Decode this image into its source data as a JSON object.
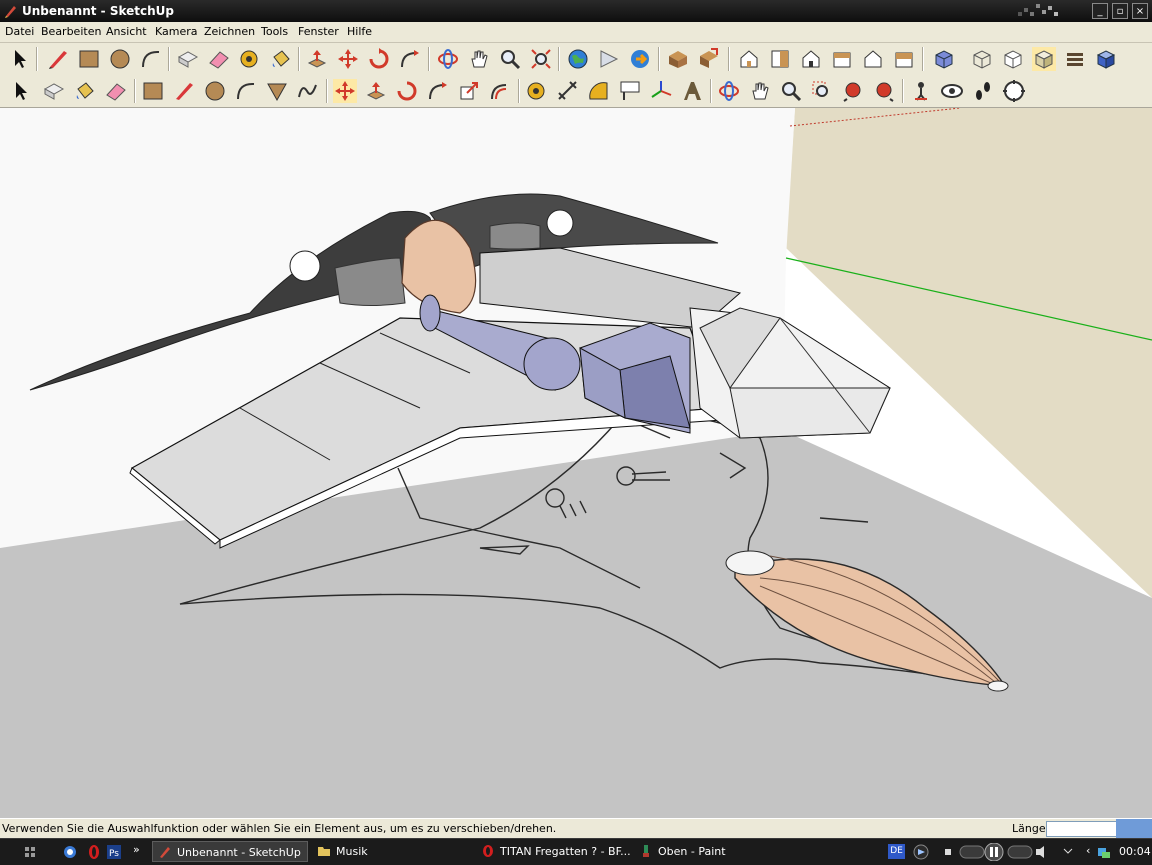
{
  "window": {
    "title": "Unbenannt - SketchUp",
    "controls": {
      "minimize": "_",
      "maximize": "▫",
      "close": "×"
    }
  },
  "menu": [
    {
      "label": "Datei"
    },
    {
      "label": "Bearbeiten"
    },
    {
      "label": "Ansicht"
    },
    {
      "label": "Kamera"
    },
    {
      "label": "Zeichnen"
    },
    {
      "label": "Tools"
    },
    {
      "label": "Fenster"
    },
    {
      "label": "Hilfe"
    }
  ],
  "toolbar1": {
    "tools": [
      "select-icon",
      "line-icon",
      "rectangle-icon",
      "circle-icon",
      "arc-icon",
      "make-component-icon",
      "eraser-icon",
      "tape-measure-icon",
      "paint-bucket-icon",
      "push-pull-icon",
      "move-icon",
      "rotate-icon",
      "follow-me-icon",
      "orbit-icon",
      "pan-icon",
      "zoom-icon",
      "zoom-extents-icon",
      "earth-icon",
      "get-models-icon",
      "share-model-icon",
      "component-icon",
      "add-component-icon",
      "iso-view-icon",
      "top-view-icon",
      "front-view-icon",
      "right-view-icon",
      "back-view-icon",
      "left-view-icon",
      "xray-icon",
      "wireframe-icon",
      "hidden-line-icon",
      "shaded-icon",
      "shaded-textures-icon",
      "monochrome-icon"
    ]
  },
  "toolbar2": {
    "tools": [
      "select-icon",
      "make-component-icon",
      "paint-bucket-icon",
      "eraser-icon",
      "rectangle-icon",
      "line-icon",
      "circle-icon",
      "arc-icon",
      "polygon-icon",
      "freehand-icon",
      "move-icon",
      "push-pull-icon",
      "rotate-icon",
      "follow-me-icon",
      "scale-icon",
      "offset-icon",
      "tape-measure-icon",
      "dimension-icon",
      "protractor-icon",
      "text-icon",
      "axes-icon",
      "3d-text-icon",
      "orbit-icon",
      "pan-icon",
      "zoom-icon",
      "zoom-window-icon",
      "previous-view-icon",
      "next-view-icon",
      "position-camera-icon",
      "look-around-icon",
      "walk-icon",
      "section-plane-icon"
    ]
  },
  "colors": {
    "sky": "#ffffff",
    "ground": "#c4c4c4",
    "back_wall": "#e3dcc5",
    "green_axis": "#19b019",
    "red_axis": "#c0392b",
    "peach": "#e9c2a5",
    "engine": "#a9abcf"
  },
  "status": {
    "message": "Verwenden Sie die Auswahlfunktion oder wählen Sie ein Element aus, um es zu verschieben/drehen.",
    "vcb_label": "Länge",
    "vcb_value": ""
  },
  "taskbar": {
    "tasks": [
      {
        "label": "Unbenannt - SketchUp",
        "icon": "sketchup-icon",
        "active": true
      },
      {
        "label": "Musik",
        "icon": "folder-icon",
        "active": false
      },
      {
        "label": "TITAN Fregatten ? - BF...",
        "icon": "opera-icon",
        "active": false
      },
      {
        "label": "Oben - Paint",
        "icon": "paint-icon",
        "active": false
      }
    ],
    "language": "DE",
    "clock": "00:04"
  }
}
